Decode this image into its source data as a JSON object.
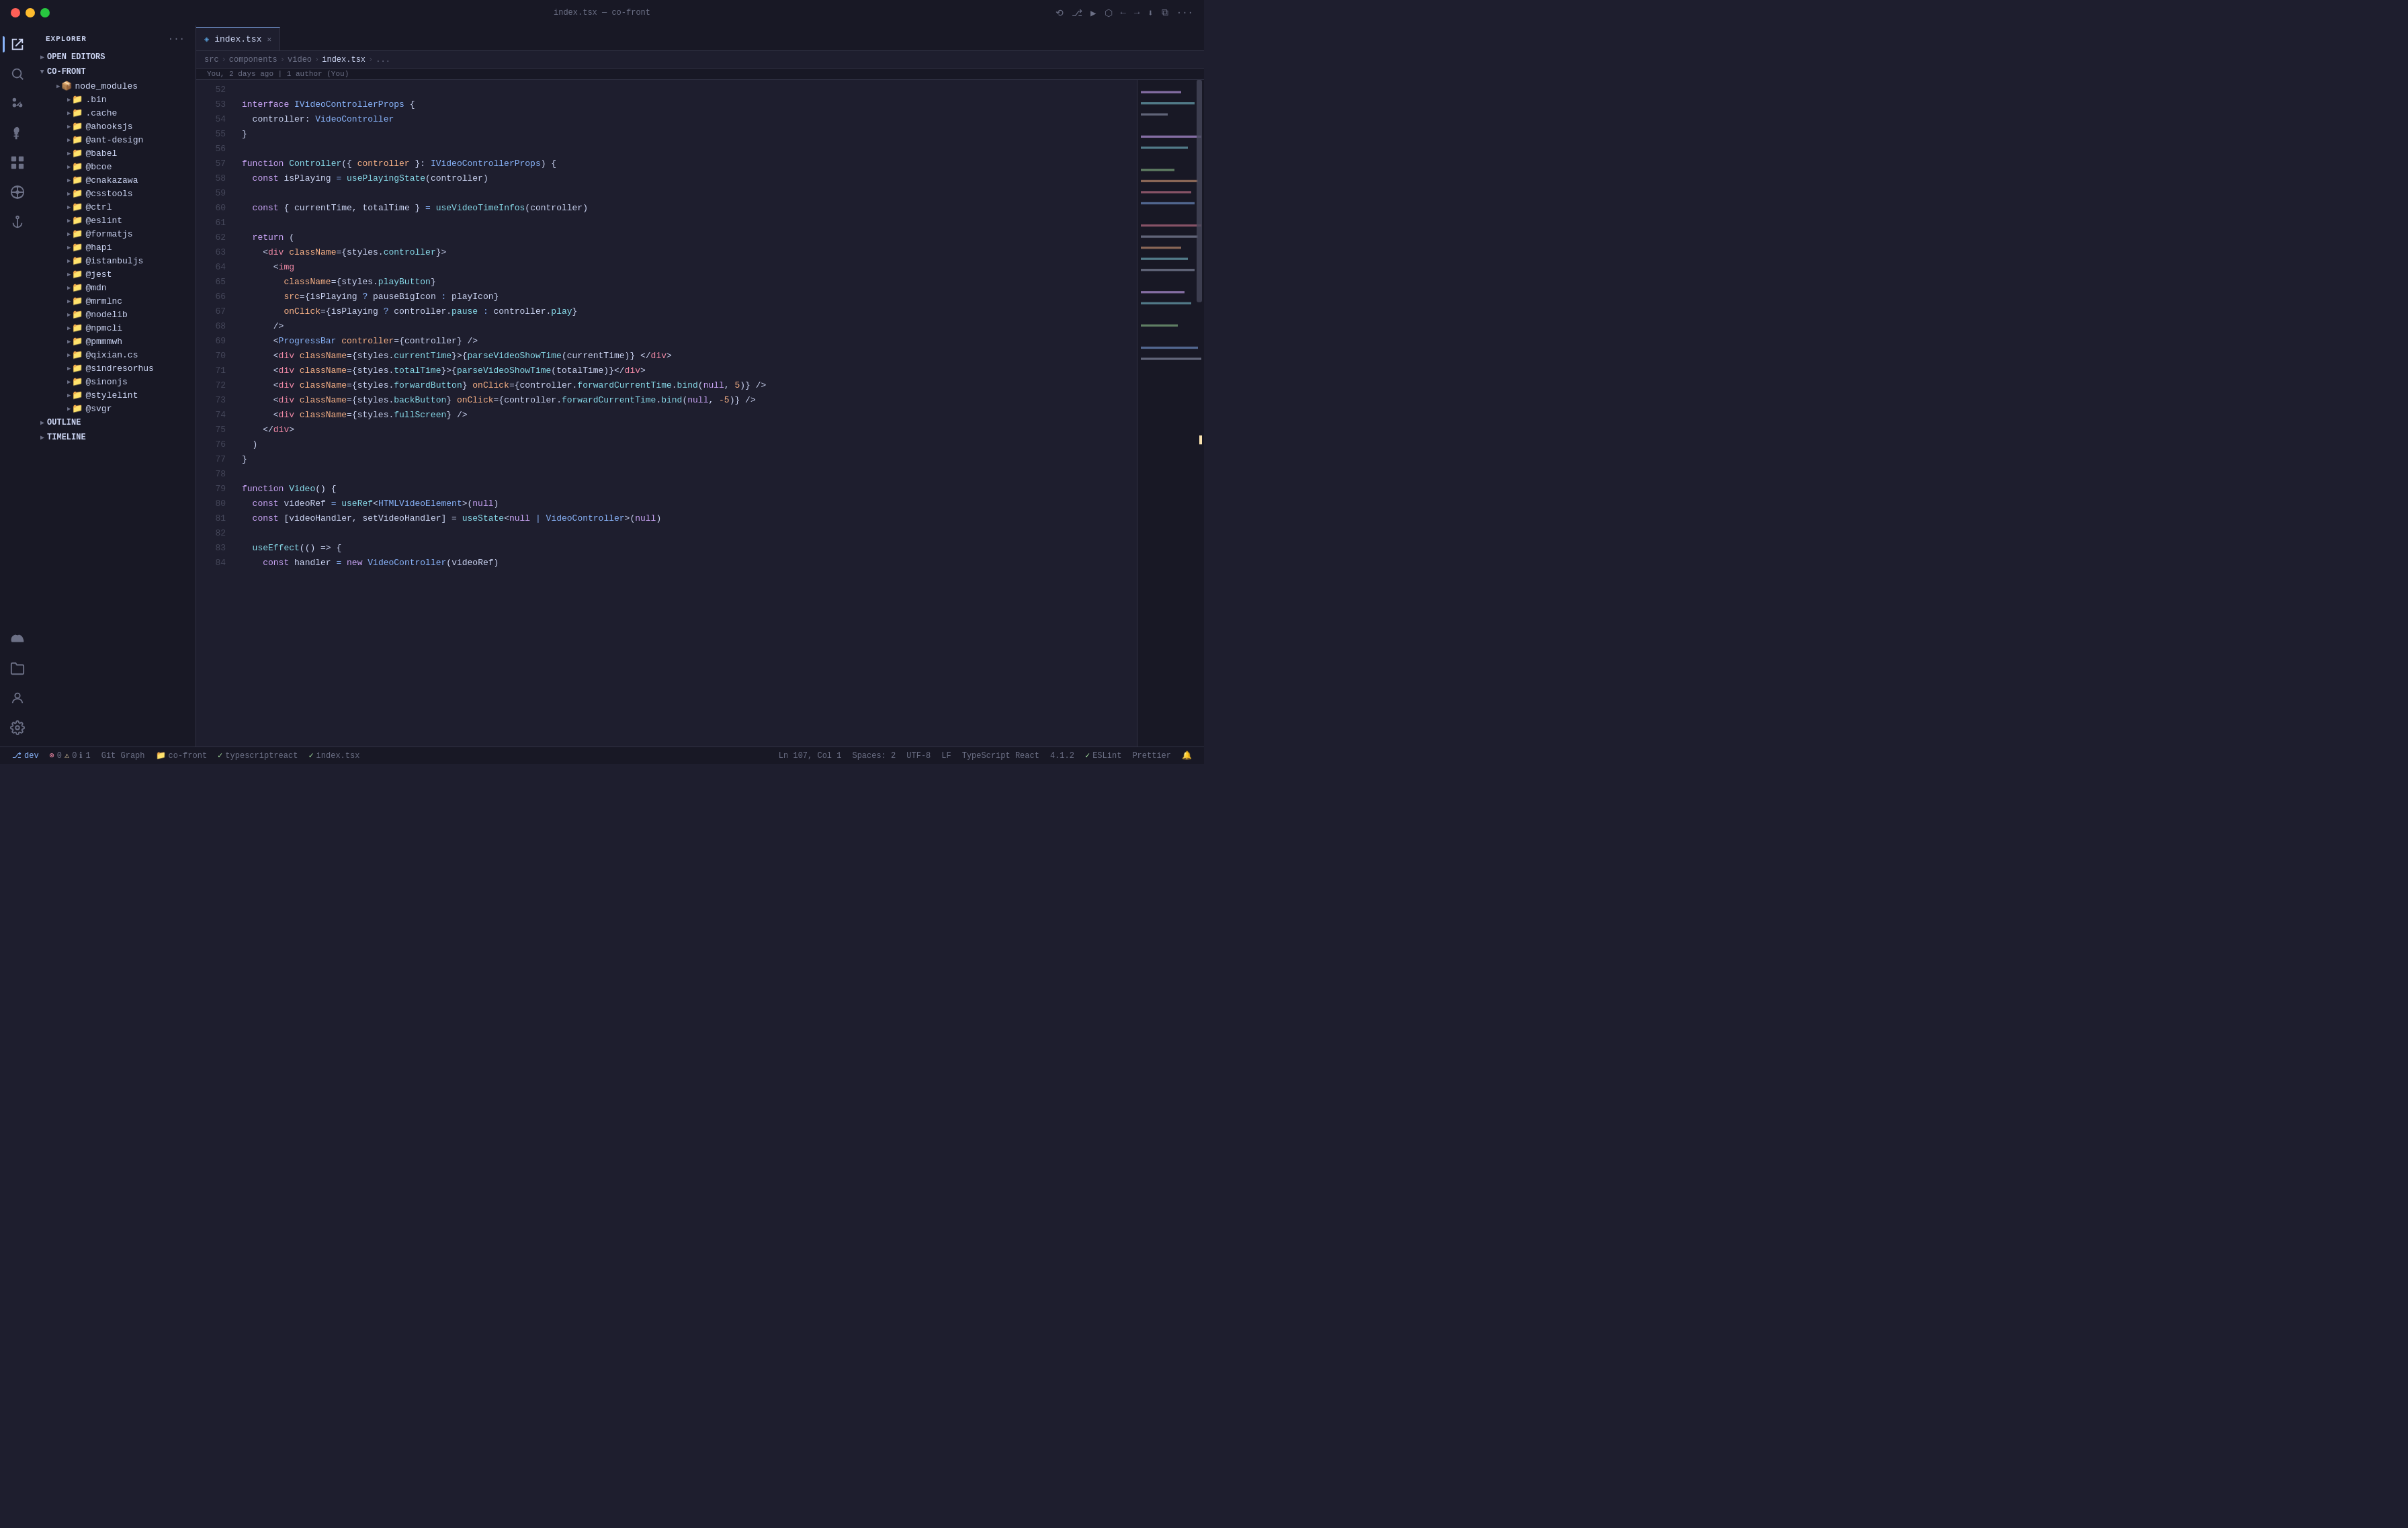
{
  "titlebar": {
    "title": "index.tsx — co-front",
    "traffic": [
      "close",
      "minimize",
      "maximize"
    ]
  },
  "sidebar": {
    "explorer_label": "EXPLORER",
    "sections": {
      "open_editors": "OPEN EDITORS",
      "co_front": "CO-FRONT",
      "outline": "OUTLINE",
      "timeline": "TIMELINE"
    },
    "tree": [
      {
        "level": 2,
        "name": "node_modules",
        "type": "folder",
        "icon": "📦",
        "expanded": false
      },
      {
        "level": 3,
        "name": ".bin",
        "type": "folder",
        "icon": "📁",
        "expanded": false
      },
      {
        "level": 3,
        "name": ".cache",
        "type": "folder",
        "icon": "📁",
        "expanded": false
      },
      {
        "level": 3,
        "name": "@ahooksjs",
        "type": "folder",
        "icon": "📁",
        "expanded": false
      },
      {
        "level": 3,
        "name": "@ant-design",
        "type": "folder",
        "icon": "📁",
        "expanded": false
      },
      {
        "level": 3,
        "name": "@babel",
        "type": "folder",
        "icon": "📁",
        "expanded": false
      },
      {
        "level": 3,
        "name": "@bcoe",
        "type": "folder",
        "icon": "📁",
        "expanded": false
      },
      {
        "level": 3,
        "name": "@cnakazawa",
        "type": "folder",
        "icon": "📁",
        "expanded": false
      },
      {
        "level": 3,
        "name": "@csstools",
        "type": "folder",
        "icon": "📁",
        "expanded": false
      },
      {
        "level": 3,
        "name": "@ctrl",
        "type": "folder",
        "icon": "📁",
        "expanded": false
      },
      {
        "level": 3,
        "name": "@eslint",
        "type": "folder",
        "icon": "📁",
        "expanded": false
      },
      {
        "level": 3,
        "name": "@formatjs",
        "type": "folder",
        "icon": "📁",
        "expanded": false
      },
      {
        "level": 3,
        "name": "@hapi",
        "type": "folder",
        "icon": "📁",
        "expanded": false
      },
      {
        "level": 3,
        "name": "@istanbuljs",
        "type": "folder",
        "icon": "📁",
        "expanded": false
      },
      {
        "level": 3,
        "name": "@jest",
        "type": "folder",
        "icon": "📁",
        "expanded": false
      },
      {
        "level": 3,
        "name": "@mdn",
        "type": "folder",
        "icon": "📁",
        "expanded": false
      },
      {
        "level": 3,
        "name": "@mrmlnc",
        "type": "folder",
        "icon": "📁",
        "expanded": false
      },
      {
        "level": 3,
        "name": "@nodelib",
        "type": "folder",
        "icon": "📁",
        "expanded": false
      },
      {
        "level": 3,
        "name": "@npmcli",
        "type": "folder",
        "icon": "📁",
        "expanded": false
      },
      {
        "level": 3,
        "name": "@pmmmwh",
        "type": "folder",
        "icon": "📁",
        "expanded": false
      },
      {
        "level": 3,
        "name": "@qixian.cs",
        "type": "folder",
        "icon": "📁",
        "expanded": false
      },
      {
        "level": 3,
        "name": "@sindresorhus",
        "type": "folder",
        "icon": "📁",
        "expanded": false
      },
      {
        "level": 3,
        "name": "@sinonjs",
        "type": "folder",
        "icon": "📁",
        "expanded": false
      },
      {
        "level": 3,
        "name": "@stylelint",
        "type": "folder",
        "icon": "📁",
        "expanded": false
      },
      {
        "level": 3,
        "name": "@svgr",
        "type": "folder",
        "icon": "📁",
        "expanded": false
      }
    ]
  },
  "editor": {
    "tab": {
      "name": "index.tsx",
      "icon": "◈"
    },
    "breadcrumb": [
      "src",
      "components",
      "video",
      "index.tsx",
      "..."
    ],
    "blame": "You, 2 days ago | 1 author (You)",
    "lines": [
      {
        "num": 52,
        "code": ""
      },
      {
        "num": 53,
        "code": "interface IVideoControllerProps {"
      },
      {
        "num": 54,
        "code": "  controller: VideoController"
      },
      {
        "num": 55,
        "code": "}"
      },
      {
        "num": 56,
        "code": ""
      },
      {
        "num": 57,
        "code": "function Controller({ controller }: IVideoControllerProps) {"
      },
      {
        "num": 58,
        "code": "  const isPlaying = usePlayingState(controller)"
      },
      {
        "num": 59,
        "code": ""
      },
      {
        "num": 60,
        "code": "  const { currentTime, totalTime } = useVideoTimeInfos(controller)"
      },
      {
        "num": 61,
        "code": ""
      },
      {
        "num": 62,
        "code": "  return ("
      },
      {
        "num": 63,
        "code": "    <div className={styles.controller}>"
      },
      {
        "num": 64,
        "code": "      <img"
      },
      {
        "num": 65,
        "code": "        className={styles.playButton}"
      },
      {
        "num": 66,
        "code": "        src={isPlaying ? pauseBigIcon : playIcon}"
      },
      {
        "num": 67,
        "code": "        onClick={isPlaying ? controller.pause : controller.play}"
      },
      {
        "num": 68,
        "code": "      />"
      },
      {
        "num": 69,
        "code": "      <ProgressBar controller={controller} />"
      },
      {
        "num": 70,
        "code": "      <div className={styles.currentTime}>{parseVideoShowTime(currentTime)} </div>"
      },
      {
        "num": 71,
        "code": "      <div className={styles.totalTime}>{parseVideoShowTime(totalTime)}</div>"
      },
      {
        "num": 72,
        "code": "      <div className={styles.forwardButton} onClick={controller.forwardCurrentTime.bind(null, 5)} />"
      },
      {
        "num": 73,
        "code": "      <div className={styles.backButton} onClick={controller.forwardCurrentTime.bind(null, -5)} />"
      },
      {
        "num": 74,
        "code": "      <div className={styles.fullScreen} />"
      },
      {
        "num": 75,
        "code": "    </div>"
      },
      {
        "num": 76,
        "code": "  )"
      },
      {
        "num": 77,
        "code": "}"
      },
      {
        "num": 78,
        "code": ""
      },
      {
        "num": 79,
        "code": "function Video() {"
      },
      {
        "num": 80,
        "code": "  const videoRef = useRef<HTMLVideoElement>(null)"
      },
      {
        "num": 81,
        "code": "  const [videoHandler, setVideoHandler] = useState<null | VideoController>(null)"
      },
      {
        "num": 82,
        "code": ""
      },
      {
        "num": 83,
        "code": "  useEffect(() => {"
      },
      {
        "num": 84,
        "code": "    const handler = new VideoController(videoRef)"
      }
    ]
  },
  "statusbar": {
    "branch": "dev",
    "errors": "0",
    "warnings": "0",
    "info": "1",
    "git_graph": "Git Graph",
    "folder": "co-front",
    "typescript": "typescriptreact",
    "file": "index.tsx",
    "position": "Ln 107, Col 1",
    "spaces": "Spaces: 2",
    "encoding": "UTF-8",
    "eol": "LF",
    "language": "TypeScript React",
    "version": "4.1.2",
    "eslint": "ESLint",
    "prettier": "Prettier",
    "bell": "🔔"
  },
  "toolbar": {
    "icons": [
      "history",
      "branches",
      "play",
      "debug",
      "back",
      "forward",
      "split",
      "more"
    ]
  }
}
